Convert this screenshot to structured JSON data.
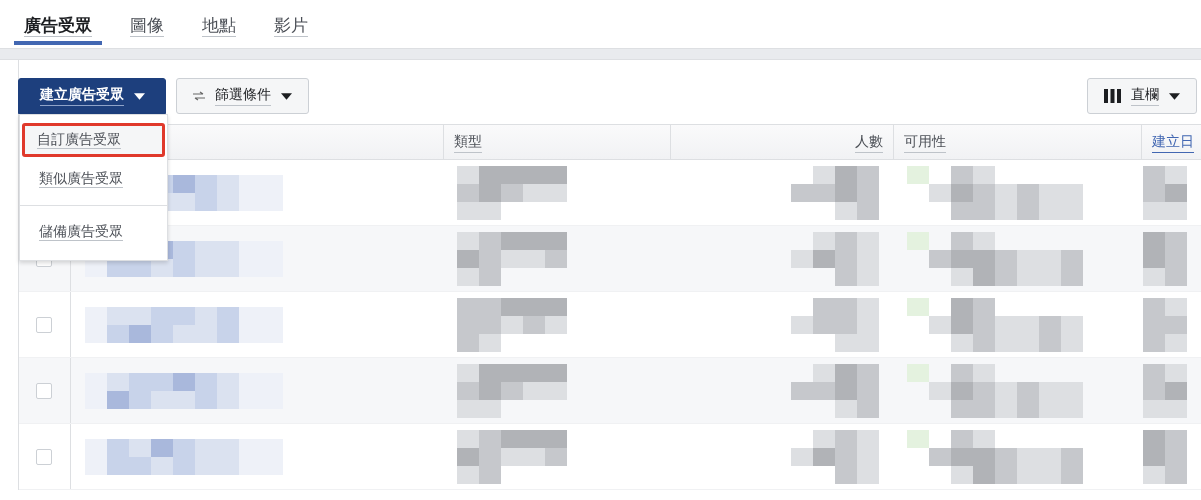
{
  "tabs": [
    {
      "label": "廣告受眾",
      "selected": true
    },
    {
      "label": "圖像",
      "selected": false
    },
    {
      "label": "地點",
      "selected": false
    },
    {
      "label": "影片",
      "selected": false
    }
  ],
  "toolbar": {
    "create_button": {
      "label": "建立廣告受眾",
      "expanded": true
    },
    "filter_button": {
      "label": "篩選條件"
    },
    "columns_button": {
      "label": "直欄"
    }
  },
  "create_menu": [
    {
      "label": "自訂廣告受眾",
      "highlighted": true
    },
    {
      "label": "類似廣告受眾",
      "highlighted": false
    },
    {
      "label": "儲備廣告受眾",
      "highlighted": false,
      "divider_before": true
    }
  ],
  "table": {
    "columns": [
      {
        "kind": "check"
      },
      {
        "kind": "name"
      },
      {
        "label": "類型",
        "kind": "type"
      },
      {
        "label": "人數",
        "kind": "count"
      },
      {
        "label": "可用性",
        "kind": "avail"
      },
      {
        "label": "建立日",
        "kind": "date",
        "sorted": true
      }
    ],
    "rows": [
      {},
      {
        "checked": false
      },
      {
        "checked": false
      },
      {
        "checked": false
      },
      {
        "checked": false
      }
    ]
  }
}
